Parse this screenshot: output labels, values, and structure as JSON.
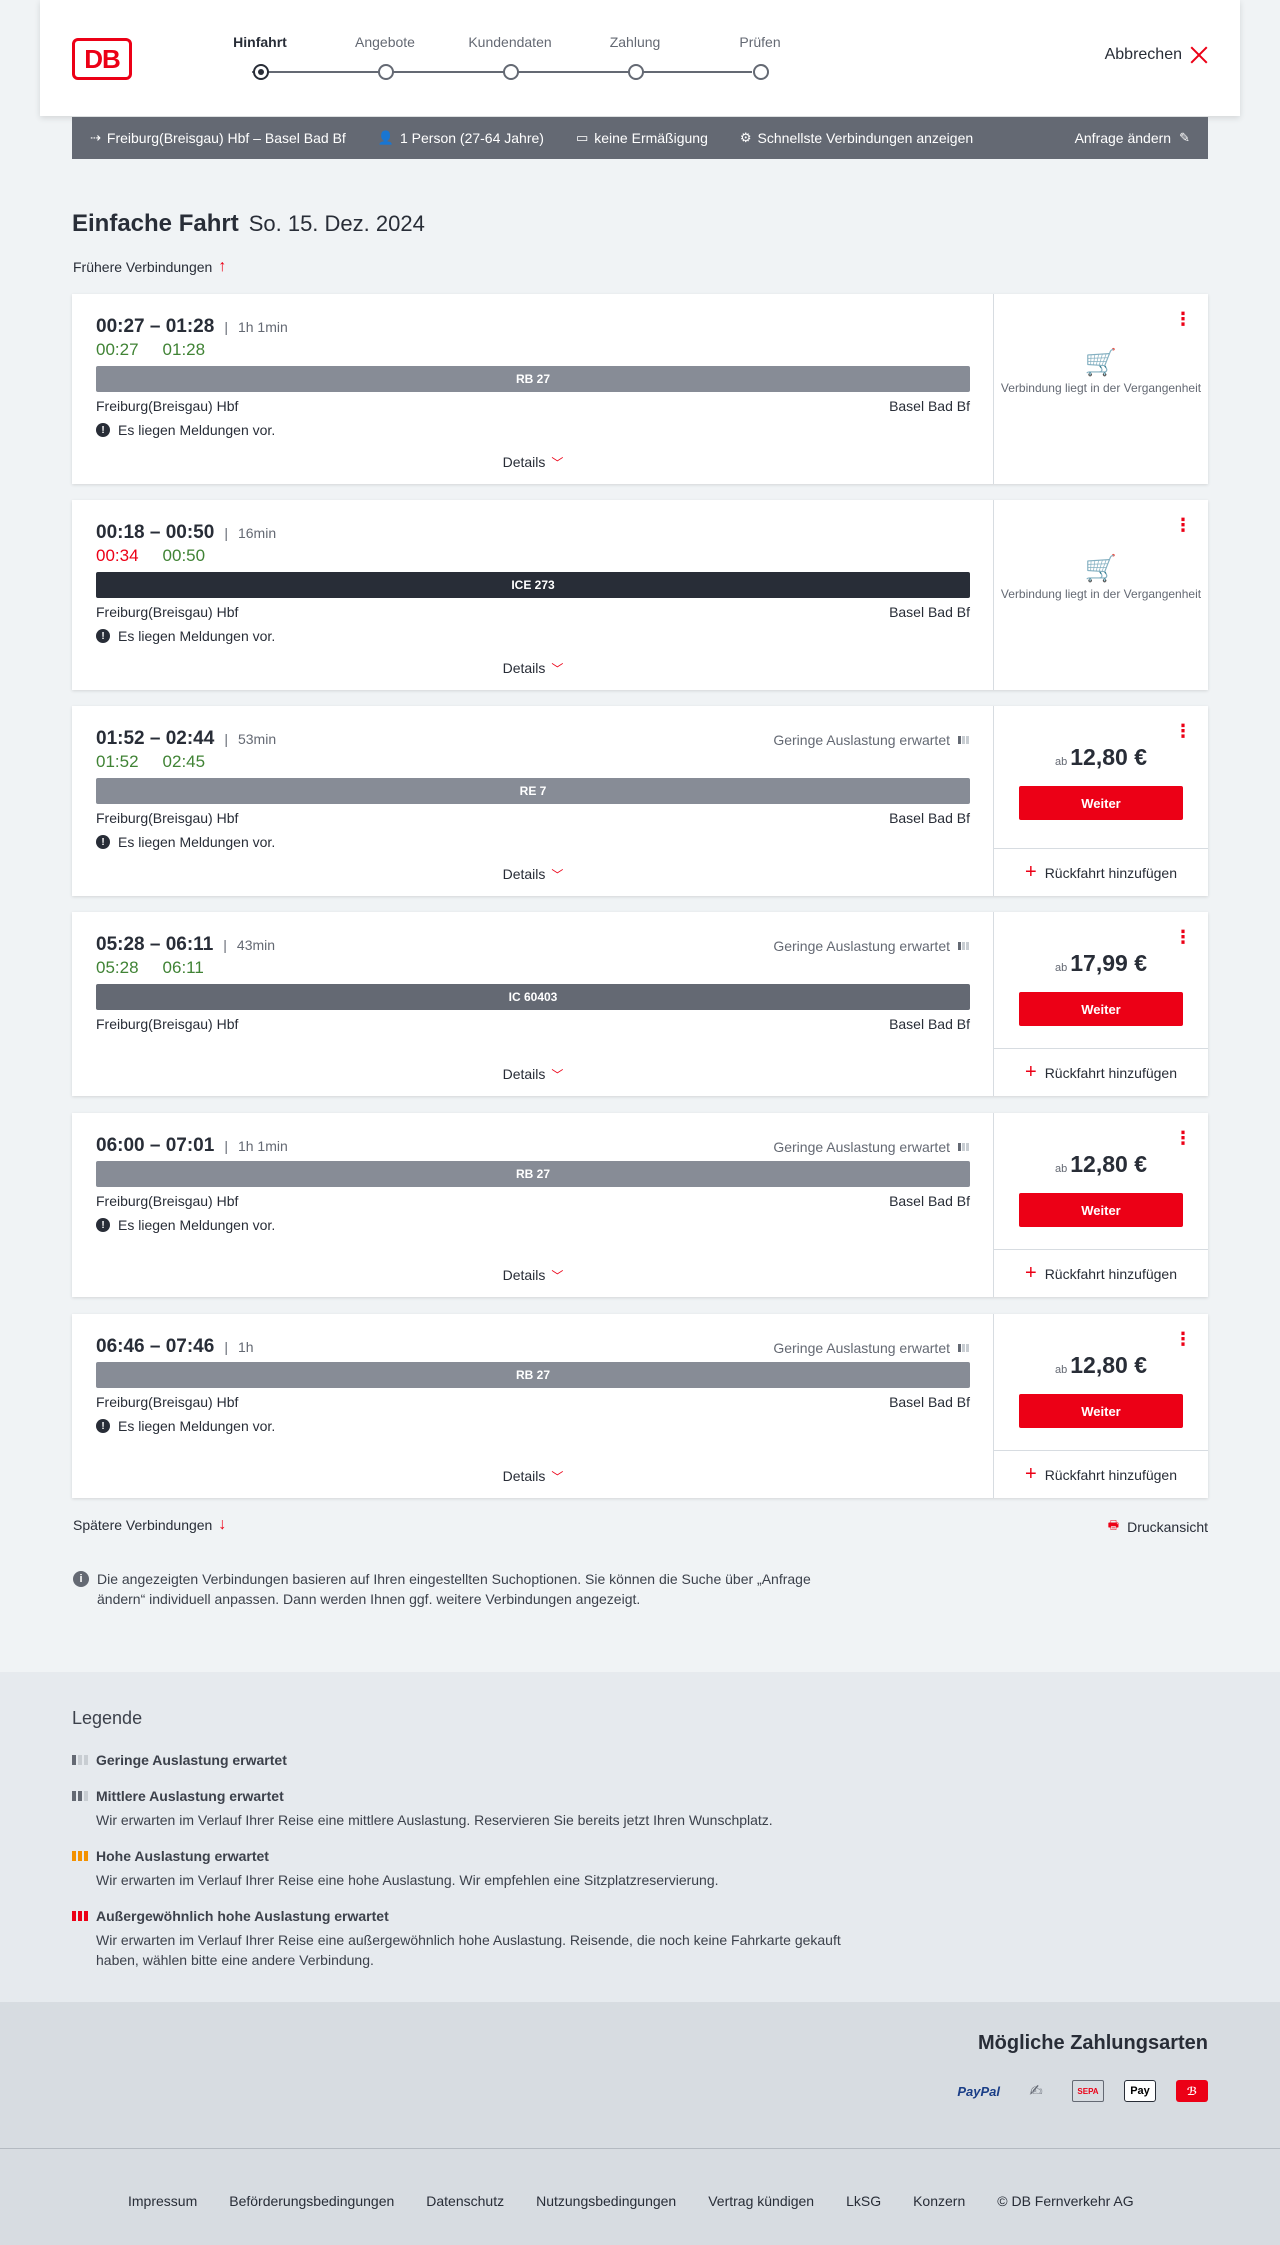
{
  "header": {
    "logo": "DB",
    "steps": [
      "Hinfahrt",
      "Angebote",
      "Kundendaten",
      "Zahlung",
      "Prüfen"
    ],
    "cancel_label": "Abbrechen"
  },
  "summary": {
    "route": "Freiburg(Breisgau) Hbf – Basel Bad Bf",
    "persons": "1 Person (27-64 Jahre)",
    "discount": "keine Ermäßigung",
    "fastest": "Schnellste Verbindungen anzeigen",
    "change": "Anfrage ändern"
  },
  "title": {
    "main": "Einfache Fahrt",
    "date": "So. 15. Dez. 2024"
  },
  "earlier_label": "Frühere Verbindungen",
  "later_label": "Spätere Verbindungen",
  "print_label": "Druckansicht",
  "details_label": "Details",
  "notice_text": "Es liegen Meldungen vor.",
  "load_text": "Geringe Auslastung erwartet",
  "past_text": "Verbindung liegt in der Vergangenheit",
  "price_prefix": "ab",
  "weiter_label": "Weiter",
  "return_label": "Rückfahrt hinzufügen",
  "connections": [
    {
      "times": "00:27 – 01:28",
      "duration": "1h 1min",
      "rt_dep": "00:27",
      "rt_arr": "01:28",
      "rt_dep_color": "green",
      "rt_arr_color": "green",
      "train": "RB 27",
      "train_color": "#878c96",
      "from": "Freiburg(Breisgau) Hbf",
      "to": "Basel Bad Bf",
      "notice": true,
      "past": true
    },
    {
      "times": "00:18 – 00:50",
      "duration": "16min",
      "rt_dep": "00:34",
      "rt_arr": "00:50",
      "rt_dep_color": "red",
      "rt_arr_color": "green",
      "train": "ICE 273",
      "train_color": "#282d37",
      "from": "Freiburg(Breisgau) Hbf",
      "to": "Basel Bad Bf",
      "notice": true,
      "past": true
    },
    {
      "times": "01:52 – 02:44",
      "duration": "53min",
      "rt_dep": "01:52",
      "rt_arr": "02:45",
      "rt_dep_color": "green",
      "rt_arr_color": "green",
      "train": "RE 7",
      "train_color": "#878c96",
      "from": "Freiburg(Breisgau) Hbf",
      "to": "Basel Bad Bf",
      "notice": true,
      "price": "12,80 €"
    },
    {
      "times": "05:28 – 06:11",
      "duration": "43min",
      "rt_dep": "05:28",
      "rt_arr": "06:11",
      "rt_dep_color": "green",
      "rt_arr_color": "green",
      "train": "IC 60403",
      "train_color": "#646973",
      "from": "Freiburg(Breisgau) Hbf",
      "to": "Basel Bad Bf",
      "notice": false,
      "price": "17,99 €"
    },
    {
      "times": "06:00 – 07:01",
      "duration": "1h 1min",
      "train": "RB 27",
      "train_color": "#878c96",
      "from": "Freiburg(Breisgau) Hbf",
      "to": "Basel Bad Bf",
      "notice": true,
      "price": "12,80 €"
    },
    {
      "times": "06:46 – 07:46",
      "duration": "1h",
      "train": "RB 27",
      "train_color": "#878c96",
      "from": "Freiburg(Breisgau) Hbf",
      "to": "Basel Bad Bf",
      "notice": true,
      "price": "12,80 €"
    }
  ],
  "info_text": "Die angezeigten Verbindungen basieren auf Ihren eingestellten Suchoptionen. Sie können die Suche über „Anfrage ändern“ individuell anpassen. Dann werden Ihnen ggf. weitere Verbindungen angezeigt.",
  "legend": {
    "title": "Legende",
    "items": [
      {
        "title": "Geringe Auslastung erwartet",
        "desc": ""
      },
      {
        "title": "Mittlere Auslastung erwartet",
        "desc": "Wir erwarten im Verlauf Ihrer Reise eine mittlere Auslastung. Reservieren Sie bereits jetzt Ihren Wunschplatz."
      },
      {
        "title": "Hohe Auslastung erwartet",
        "desc": "Wir erwarten im Verlauf Ihrer Reise eine hohe Auslastung. Wir empfehlen eine Sitzplatzreservierung."
      },
      {
        "title": "Außergewöhnlich hohe Auslastung erwartet",
        "desc": "Wir erwarten im Verlauf Ihrer Reise eine außergewöhnlich hohe Auslastung. Reisende, die noch keine Fahrkarte gekauft haben, wählen bitte eine andere Verbindung."
      }
    ]
  },
  "payments": {
    "title": "Mögliche Zahlungsarten",
    "paypal": "PayPal",
    "applepay": "Pay"
  },
  "footer": [
    "Impressum",
    "Beförderungsbedingungen",
    "Datenschutz",
    "Nutzungsbedingungen",
    "Vertrag kündigen",
    "LkSG",
    "Konzern",
    "© DB Fernverkehr AG"
  ],
  "colors": {
    "accent": "#ec0016",
    "green": "#408335",
    "bar": "#646973"
  }
}
